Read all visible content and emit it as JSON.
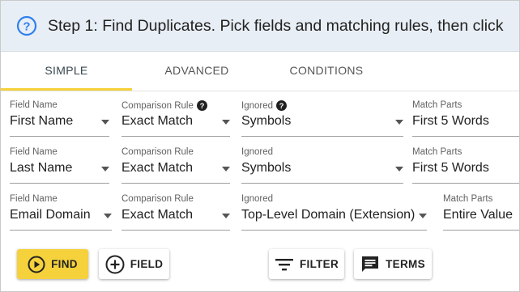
{
  "banner": {
    "title": "Step 1: Find Duplicates. Pick fields and matching rules, then click",
    "icon": "help-circle-icon",
    "accent": "#2f80ed"
  },
  "tabs": [
    {
      "label": "SIMPLE",
      "active": true
    },
    {
      "label": "ADVANCED",
      "active": false
    },
    {
      "label": "CONDITIONS",
      "active": false
    }
  ],
  "rows": [
    {
      "field_name_label": "Field Name",
      "field_name": "First Name",
      "comparison_label": "Comparison Rule",
      "comparison": "Exact Match",
      "ignored_label": "Ignored",
      "ignored": "Symbols",
      "match_parts_label": "Match Parts",
      "match_parts": "First 5 Words"
    },
    {
      "field_name_label": "Field Name",
      "field_name": "Last Name",
      "comparison_label": "Comparison Rule",
      "comparison": "Exact Match",
      "ignored_label": "Ignored",
      "ignored": "Symbols",
      "match_parts_label": "Match Parts",
      "match_parts": "First 5 Words"
    },
    {
      "field_name_label": "Field Name",
      "field_name": "Email Domain",
      "comparison_label": "Comparison Rule",
      "comparison": "Exact Match",
      "ignored_label": "Ignored",
      "ignored": "Top-Level Domain (Extension)",
      "match_parts_label": "Match Parts",
      "match_parts": "Entire Value"
    }
  ],
  "buttons": {
    "find": "FIND",
    "field": "FIELD",
    "filter": "FILTER",
    "terms": "TERMS"
  },
  "colors": {
    "primary_button": "#f5d13b",
    "tab_indicator": "#f5d13b",
    "banner_bg": "#e8eef5"
  }
}
